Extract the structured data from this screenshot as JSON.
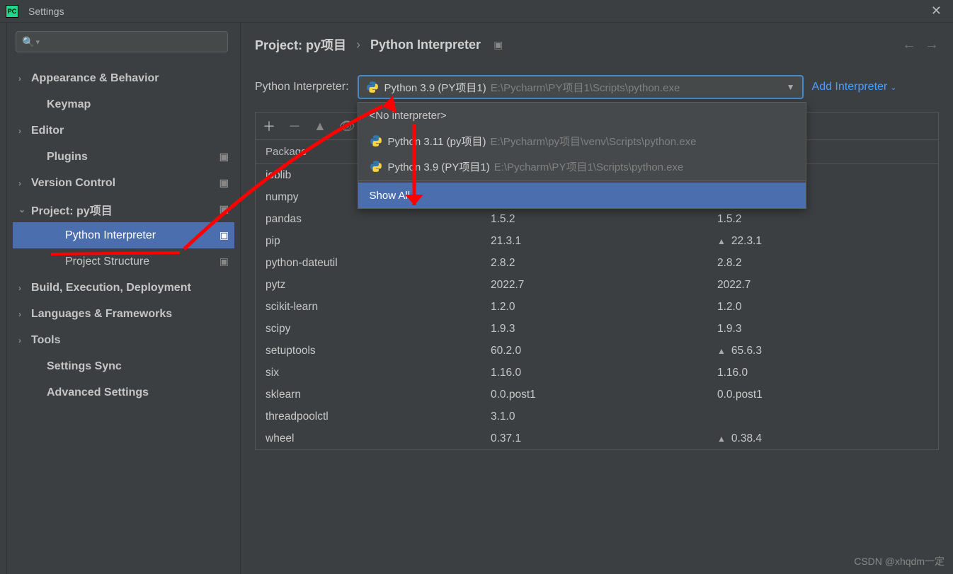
{
  "window": {
    "title": "Settings"
  },
  "sidebar": {
    "search_placeholder": "",
    "items": [
      {
        "label": "Appearance & Behavior",
        "chev": true,
        "bold": true
      },
      {
        "label": "Keymap",
        "indent": 1,
        "bold": true
      },
      {
        "label": "Editor",
        "chev": true,
        "bold": true
      },
      {
        "label": "Plugins",
        "indent": 1,
        "bold": true,
        "cfg": true
      },
      {
        "label": "Version Control",
        "chev": true,
        "bold": true,
        "cfg": true
      },
      {
        "label": "Project: py项目",
        "chev": true,
        "expanded": true,
        "bold": true,
        "cfg": true
      },
      {
        "label": "Python Interpreter",
        "indent": 2,
        "selected": true,
        "cfg": true
      },
      {
        "label": "Project Structure",
        "indent": 2,
        "cfg": true
      },
      {
        "label": "Build, Execution, Deployment",
        "chev": true,
        "bold": true
      },
      {
        "label": "Languages & Frameworks",
        "chev": true,
        "bold": true
      },
      {
        "label": "Tools",
        "chev": true,
        "bold": true
      },
      {
        "label": "Settings Sync",
        "indent": 1,
        "bold": true
      },
      {
        "label": "Advanced Settings",
        "indent": 1,
        "bold": true
      }
    ]
  },
  "breadcrumb": {
    "part1": "Project: py项目",
    "sep": "›",
    "part2": "Python Interpreter"
  },
  "interpreter": {
    "label": "Python Interpreter:",
    "selected_name": "Python 3.9 (PY项目1)",
    "selected_path": "E:\\Pycharm\\PY项目1\\Scripts\\python.exe",
    "add_label": "Add Interpreter",
    "dropdown": {
      "no_interpreter": "<No interpreter>",
      "options": [
        {
          "name": "Python 3.11 (py项目)",
          "path": "E:\\Pycharm\\py项目\\venv\\Scripts\\python.exe"
        },
        {
          "name": "Python 3.9 (PY项目1)",
          "path": "E:\\Pycharm\\PY项目1\\Scripts\\python.exe"
        }
      ],
      "show_all": "Show All..."
    }
  },
  "table": {
    "header_package": "Package",
    "packages": [
      {
        "name": "joblib",
        "version": "",
        "latest": ""
      },
      {
        "name": "numpy",
        "version": "",
        "latest": ""
      },
      {
        "name": "pandas",
        "version": "1.5.2",
        "latest": "1.5.2"
      },
      {
        "name": "pip",
        "version": "21.3.1",
        "latest": "22.3.1",
        "upgrade": true
      },
      {
        "name": "python-dateutil",
        "version": "2.8.2",
        "latest": "2.8.2"
      },
      {
        "name": "pytz",
        "version": "2022.7",
        "latest": "2022.7"
      },
      {
        "name": "scikit-learn",
        "version": "1.2.0",
        "latest": "1.2.0"
      },
      {
        "name": "scipy",
        "version": "1.9.3",
        "latest": "1.9.3"
      },
      {
        "name": "setuptools",
        "version": "60.2.0",
        "latest": "65.6.3",
        "upgrade": true
      },
      {
        "name": "six",
        "version": "1.16.0",
        "latest": "1.16.0"
      },
      {
        "name": "sklearn",
        "version": "0.0.post1",
        "latest": "0.0.post1"
      },
      {
        "name": "threadpoolctl",
        "version": "3.1.0",
        "latest": ""
      },
      {
        "name": "wheel",
        "version": "0.37.1",
        "latest": "0.38.4",
        "upgrade": true
      }
    ]
  },
  "watermark": "CSDN @xhqdm一定"
}
